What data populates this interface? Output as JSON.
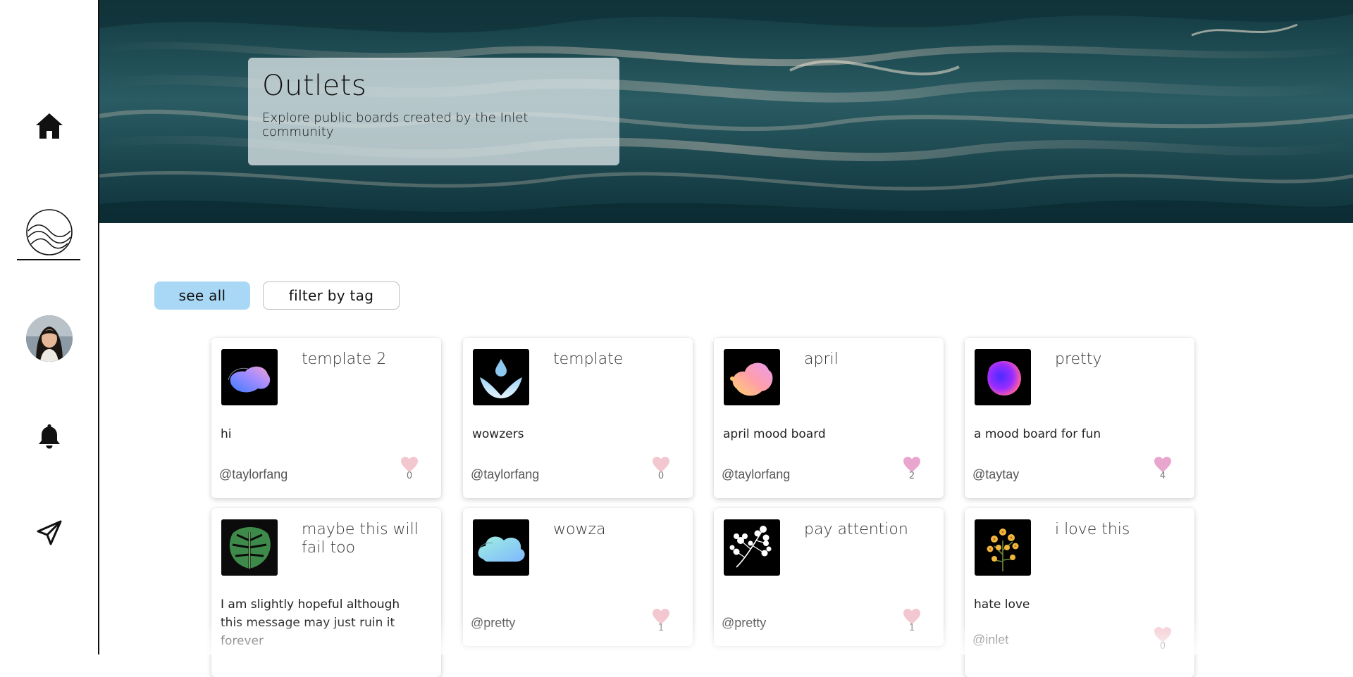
{
  "sidebar": {
    "items": [
      {
        "name": "home",
        "icon": "home-icon"
      },
      {
        "name": "inlet-logo",
        "icon": "waves-logo-icon"
      },
      {
        "name": "profile",
        "icon": "avatar"
      },
      {
        "name": "notifications",
        "icon": "bell-icon"
      },
      {
        "name": "send",
        "icon": "paper-plane-icon"
      }
    ]
  },
  "hero": {
    "title": "Outlets",
    "subtitle": "Explore public boards created by the Inlet community"
  },
  "filters": {
    "see_all": "see all",
    "filter_by_tag": "filter by tag"
  },
  "colors": {
    "accent": "#a8d8f5",
    "heart_liked": "#e8a6cf",
    "heart_unliked": "#f3c7cf"
  },
  "boards": [
    {
      "title": "template 2",
      "description": "hi",
      "user": "@taylorfang",
      "likes": "0",
      "liked": false,
      "thumb": "blob-blue-pink"
    },
    {
      "title": "template",
      "description": "wowzers",
      "user": "@taylorfang",
      "likes": "0",
      "liked": false,
      "thumb": "water-drop"
    },
    {
      "title": "april",
      "description": "april mood board",
      "user": "@taylorfang",
      "likes": "2",
      "liked": true,
      "thumb": "blob-pink-yellow"
    },
    {
      "title": "pretty",
      "description": "a mood board for fun",
      "user": "@taytay",
      "likes": "4",
      "liked": true,
      "thumb": "blob-purple"
    },
    {
      "title": "maybe this will fail too",
      "description": "I am slightly hopeful although this message may just ruin it forever",
      "user": "",
      "likes": "",
      "liked": false,
      "thumb": "monstera-leaf"
    },
    {
      "title": "wowza",
      "description": "",
      "user": "@pretty",
      "likes": "1",
      "liked": false,
      "thumb": "cloud"
    },
    {
      "title": "pay attention",
      "description": "",
      "user": "@pretty",
      "likes": "1",
      "liked": false,
      "thumb": "white-flowers"
    },
    {
      "title": "i love this",
      "description": "hate love",
      "user": "@inlet",
      "likes": "0",
      "liked": false,
      "thumb": "yellow-flowers"
    }
  ]
}
